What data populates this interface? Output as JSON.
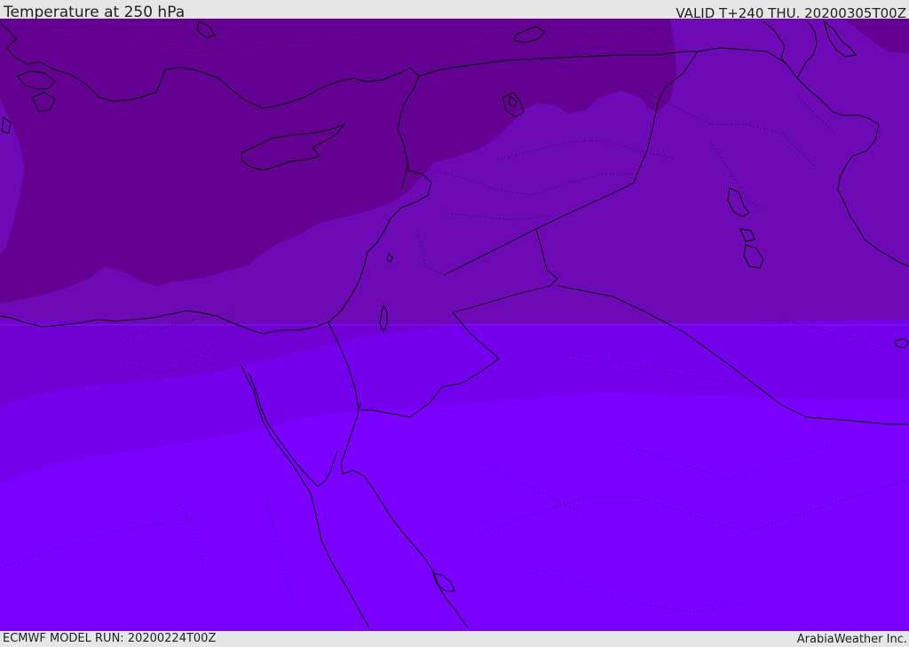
{
  "header": {
    "title": "Temperature at 250 hPa",
    "valid": "VALID T+240 THU. 20200305T00Z"
  },
  "footer": {
    "model_run": "ECMWF MODEL RUN: 20200224T00Z",
    "credit": "ArabiaWeather Inc."
  },
  "map": {
    "field": "temperature",
    "level": "250 hPa",
    "bands": [
      {
        "band": "warmest",
        "color": "#7b00ff"
      },
      {
        "band": "warm",
        "color": "#7400ec"
      },
      {
        "band": "mid",
        "color": "#7100d3"
      },
      {
        "band": "cool",
        "color": "#6e0ab5"
      },
      {
        "band": "coldest",
        "color": "#640092"
      }
    ],
    "coastline_color": "#000000",
    "border_style": "dotted"
  }
}
